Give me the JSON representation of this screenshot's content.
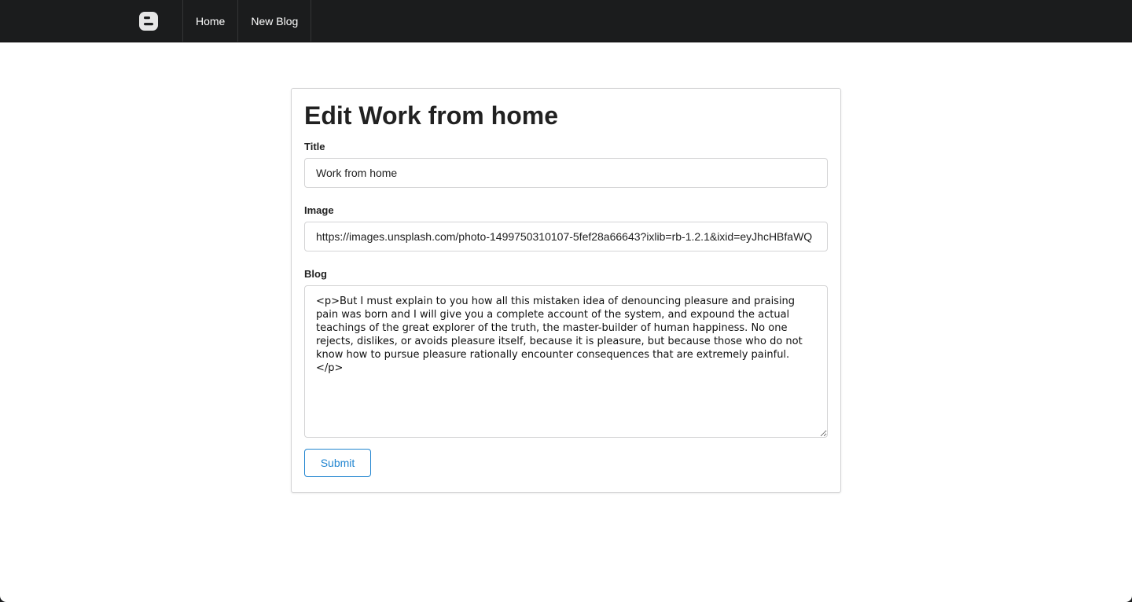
{
  "navbar": {
    "logo_icon": "blogger-logo-icon",
    "items": [
      {
        "label": "Home"
      },
      {
        "label": "New Blog"
      }
    ]
  },
  "form": {
    "heading": "Edit Work from home",
    "title_label": "Title",
    "title_value": "Work from home",
    "image_label": "Image",
    "image_value": "https://images.unsplash.com/photo-1499750310107-5fef28a66643?ixlib=rb-1.2.1&ixid=eyJhcHBfaWQ",
    "blog_label": "Blog",
    "blog_value": "<p>But I must explain to you how all this mistaken idea of denouncing pleasure and praising pain was born and I will give you a complete account of the system, and expound the actual teachings of the great explorer of the truth, the master-builder of human happiness. No one rejects, dislikes, or avoids pleasure itself, because it is pleasure, but because those who do not know how to pursue pleasure rationally encounter consequences that are extremely painful.</p>",
    "submit_label": "Submit"
  },
  "colors": {
    "navbar_bg": "#1b1c1d",
    "accent": "#2185d0"
  }
}
